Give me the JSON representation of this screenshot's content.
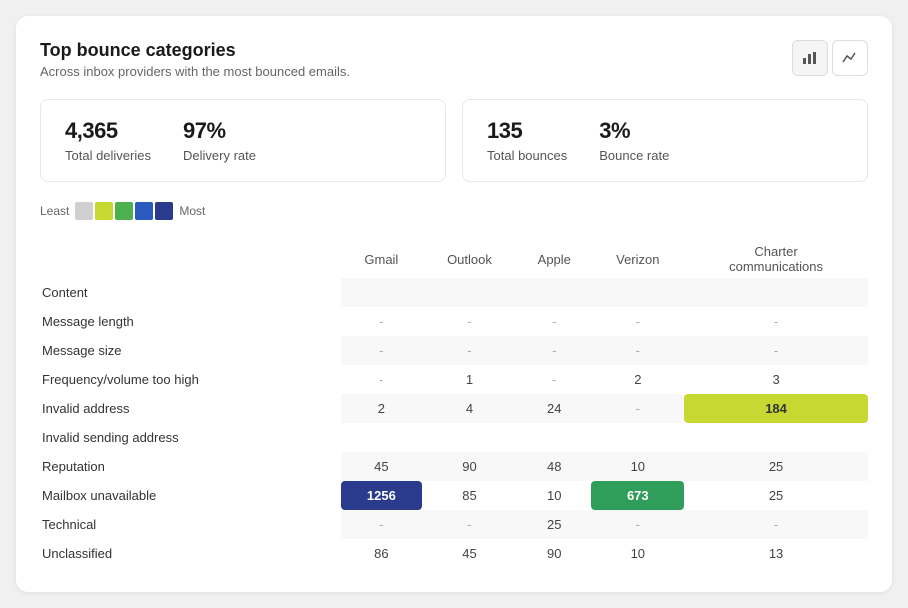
{
  "header": {
    "title": "Top bounce categories",
    "subtitle": "Across inbox providers with the most bounced emails.",
    "chart_bar_label": "bar-chart",
    "chart_line_label": "line-chart"
  },
  "stats": {
    "left": {
      "deliveries_value": "4,365",
      "deliveries_label": "Total deliveries",
      "rate_value": "97%",
      "rate_label": "Delivery rate"
    },
    "right": {
      "bounces_value": "135",
      "bounces_label": "Total bounces",
      "bounce_rate_value": "3%",
      "bounce_rate_label": "Bounce rate"
    }
  },
  "legend": {
    "least_label": "Least",
    "most_label": "Most",
    "colors": [
      "#d0d0d0",
      "#c8d832",
      "#4caf50",
      "#2a5abf",
      "#2a3a8c"
    ]
  },
  "table": {
    "columns": [
      "Gmail",
      "Outlook",
      "Apple",
      "Verizon",
      "Charter\ncommunications"
    ],
    "rows": [
      {
        "label": "Content",
        "values": [
          "",
          "",
          "",
          "",
          ""
        ]
      },
      {
        "label": "Message length",
        "values": [
          "-",
          "-",
          "-",
          "-",
          "-"
        ]
      },
      {
        "label": "Message size",
        "values": [
          "-",
          "-",
          "-",
          "-",
          "-"
        ]
      },
      {
        "label": "Frequency/volume too high",
        "values": [
          "-",
          "1",
          "-",
          "2",
          "3"
        ]
      },
      {
        "label": "Invalid address",
        "values": [
          "2",
          "4",
          "24",
          "-",
          "184"
        ],
        "highlight": [
          4
        ]
      },
      {
        "label": "Invalid sending address",
        "values": [
          "",
          "",
          "",
          "",
          ""
        ]
      },
      {
        "label": "Reputation",
        "values": [
          "45",
          "90",
          "48",
          "10",
          "25"
        ]
      },
      {
        "label": "Mailbox unavailable",
        "values": [
          "1256",
          "85",
          "10",
          "673",
          "25"
        ],
        "highlight_blue": [
          0
        ],
        "highlight_green": [
          3
        ]
      },
      {
        "label": "Technical",
        "values": [
          "-",
          "-",
          "25",
          "-",
          "-"
        ]
      },
      {
        "label": "Unclassified",
        "values": [
          "86",
          "45",
          "90",
          "10",
          "13"
        ]
      }
    ]
  }
}
